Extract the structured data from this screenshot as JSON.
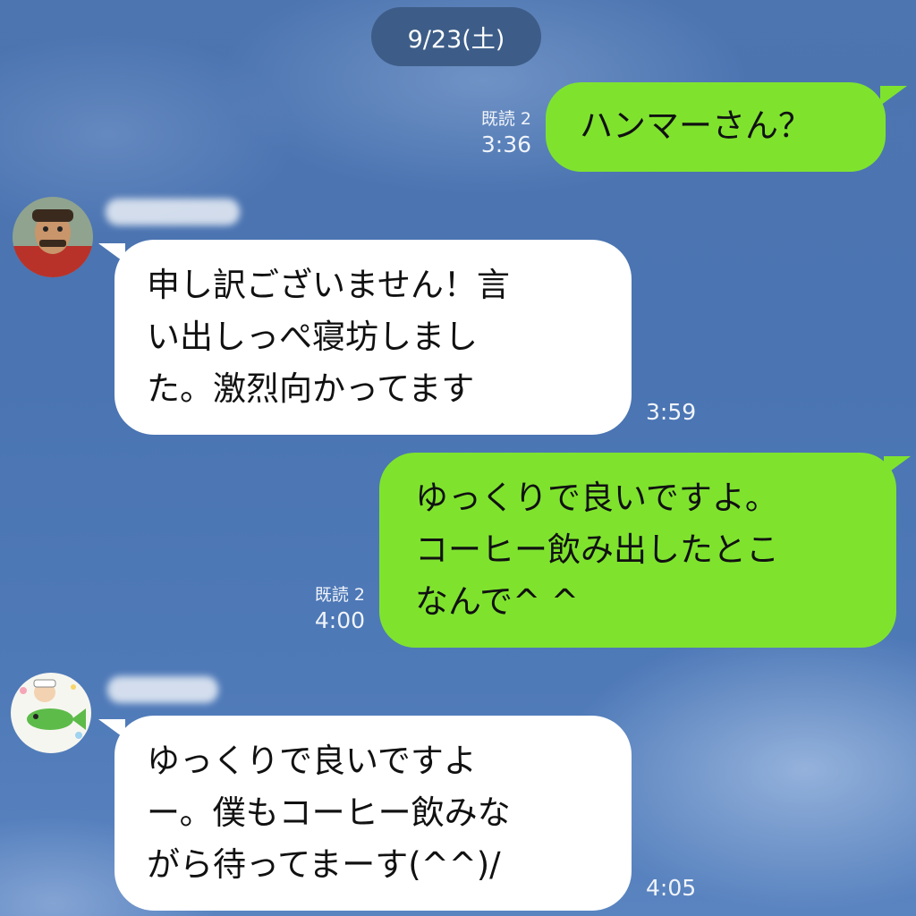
{
  "date_separator": "9/23(土)",
  "messages": [
    {
      "side": "me",
      "lines": [
        "ハンマーさん？"
      ],
      "read_status": "既読 2",
      "time": "3:36"
    },
    {
      "side": "other",
      "lines": [
        "申し訳ございません！言",
        "い出しっぺ寝坊しまし",
        "た。激烈向かってます"
      ],
      "time": "3:59"
    },
    {
      "side": "me",
      "lines": [
        "ゆっくりで良いですよ。",
        "コーヒー飲み出したとこ",
        "なんで^ ^"
      ],
      "read_status": "既読 2",
      "time": "4:00"
    },
    {
      "side": "other",
      "lines": [
        "ゆっくりで良いですよ",
        "ー。僕もコーヒー飲みな",
        "がら待ってまーす(^^)/"
      ],
      "time": "4:05"
    }
  ],
  "colors": {
    "my_bubble": "#7fe32e",
    "their_bubble": "#ffffff",
    "date_pill": "#3d5d88",
    "background": "#4d75b0"
  }
}
